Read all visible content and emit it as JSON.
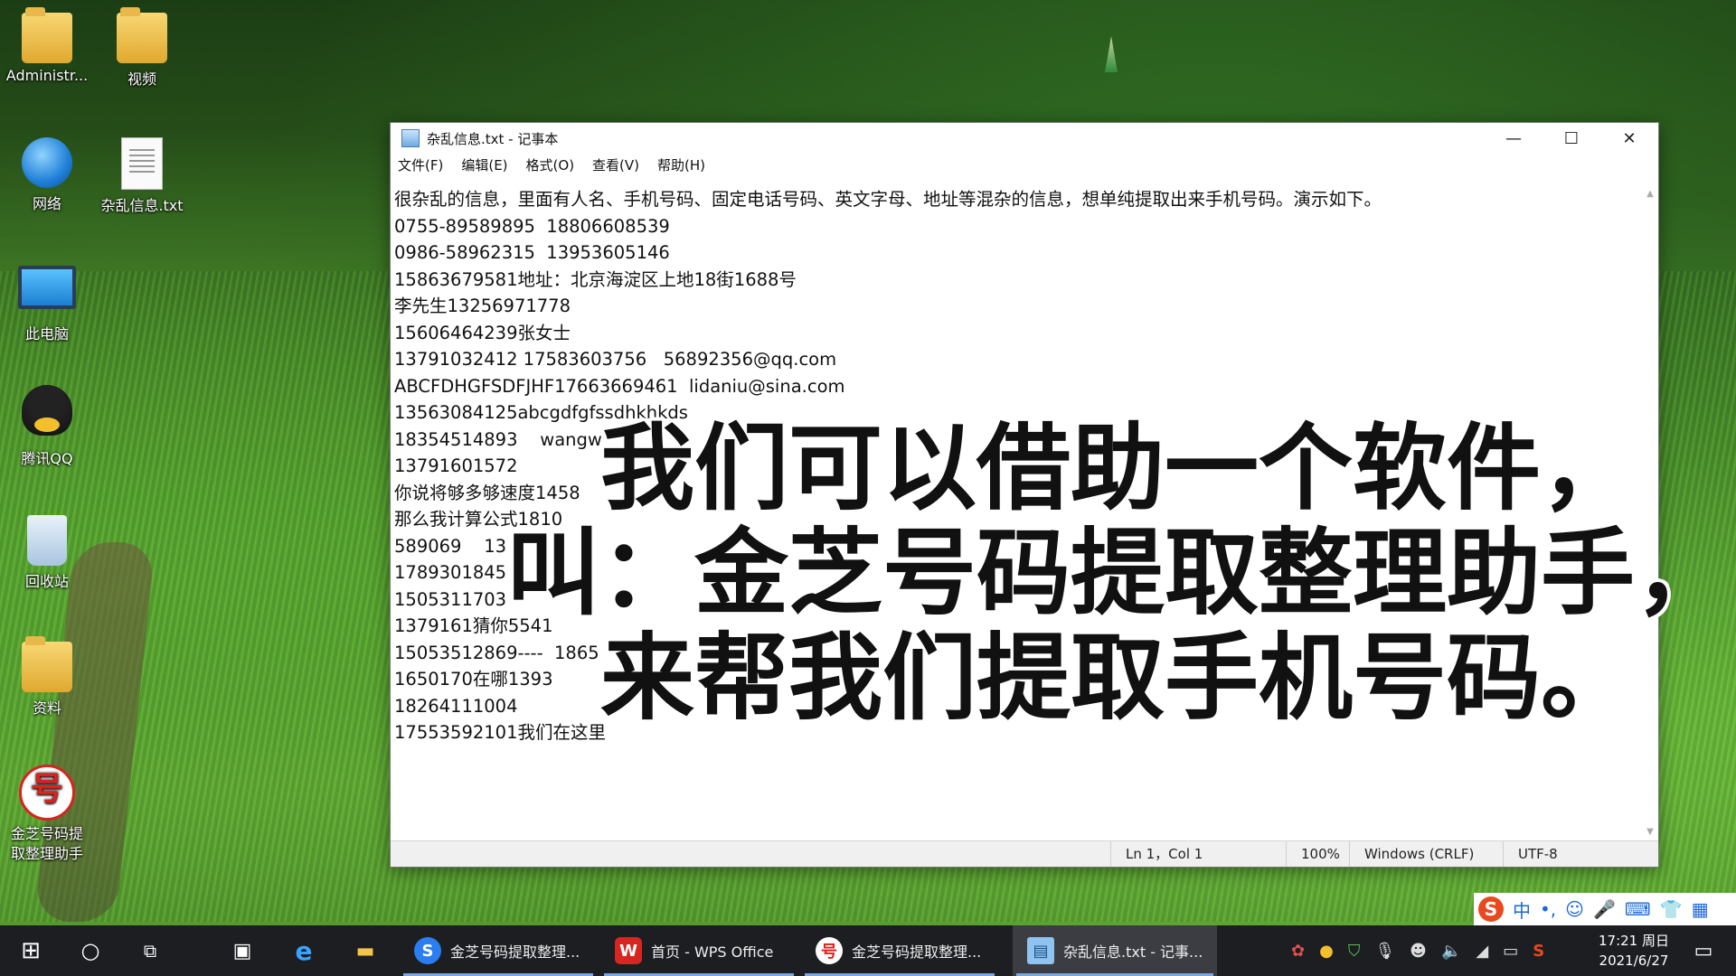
{
  "desktop": {
    "icons": [
      {
        "label": "Administr...",
        "icon": "user-folder-icon"
      },
      {
        "label": "视频",
        "icon": "video-folder-icon"
      },
      {
        "label": "网络",
        "icon": "network-icon"
      },
      {
        "label": "杂乱信息.txt",
        "icon": "text-file-icon"
      },
      {
        "label": "此电脑",
        "icon": "computer-icon"
      },
      {
        "label": "腾讯QQ",
        "icon": "qq-icon"
      },
      {
        "label": "回收站",
        "icon": "recycle-bin-icon"
      },
      {
        "label": "资料",
        "icon": "folder-icon"
      },
      {
        "label": "金芝号码提\n取整理助手",
        "icon": "jinzhi-app-icon",
        "glyph": "号"
      }
    ]
  },
  "notepad": {
    "title": "杂乱信息.txt - 记事本",
    "controls": {
      "minimize": "—",
      "maximize": "☐",
      "close": "✕"
    },
    "menu": [
      "文件(F)",
      "编辑(E)",
      "格式(O)",
      "查看(V)",
      "帮助(H)"
    ],
    "lines": [
      "很杂乱的信息，里面有人名、手机号码、固定电话号码、英文字母、地址等混杂的信息，想单纯提取出来手机号码。演示如下。",
      "0755-89589895  18806608539",
      "0986-58962315  13953605146",
      "15863679581地址：北京海淀区上地18街1688号",
      "李先生13256971778",
      "15606464239张女士",
      "13791032412 17583603756   56892356@qq.com",
      "ABCFDHGFSDFJHF17663669461  lidaniu@sina.com",
      "13563084125abcgdfgfssdhkhkds",
      "18354514893    wangw",
      "13791601572",
      "你说将够多够速度1458",
      "那么我计算公式1810",
      "589069    13",
      "1789301845",
      "1505311703",
      "1379161猜你5541",
      "15053512869----  1865",
      "1650170在哪1393",
      "18264111004",
      "17553592101我们在这里"
    ],
    "status": {
      "position": "Ln 1，Col 1",
      "zoom": "100%",
      "line_ending": "Windows (CRLF)",
      "encoding": "UTF-8"
    }
  },
  "caption": {
    "line1": "我们可以借助一个软件，",
    "line2": "叫：金芝号码提取整理助手，",
    "line3": "来帮我们提取手机号码。"
  },
  "ime": {
    "brand": "S",
    "mode": "中",
    "punct": "•,",
    "emoji": "☺",
    "mic": "🎤",
    "keyboard": "⌨",
    "skin": "👕",
    "grid": "▦"
  },
  "taskbar": {
    "tasks": [
      {
        "label": "金芝号码提取整理...",
        "glyph": "S"
      },
      {
        "label": "首页 - WPS Office",
        "glyph": "W"
      },
      {
        "label": "金芝号码提取整理...",
        "glyph": "号"
      },
      {
        "label": "杂乱信息.txt - 记事...",
        "glyph": "▤"
      }
    ],
    "time": "17:21 周日",
    "date": "2021/6/27"
  }
}
